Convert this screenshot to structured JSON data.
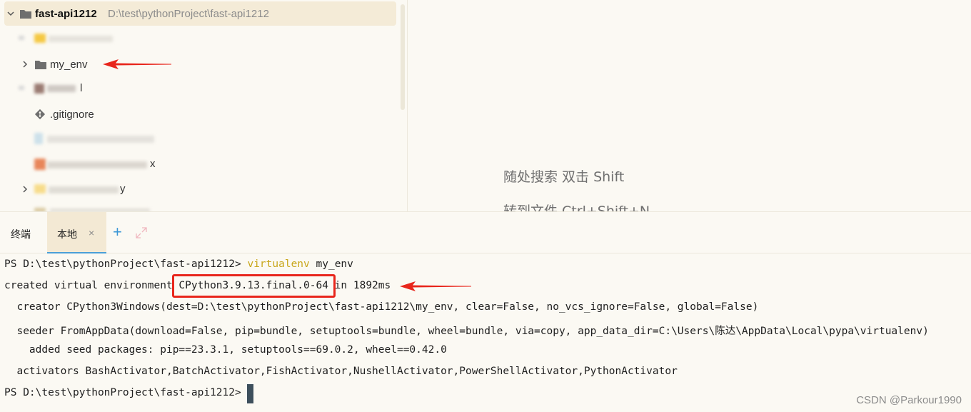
{
  "project": {
    "root_name": "fast-api1212",
    "root_path": "D:\\test\\pythonProject\\fast-api1212",
    "items": [
      {
        "label": "my_env",
        "kind": "folder",
        "expandable": true
      },
      {
        "label": ".gitignore",
        "kind": "file",
        "expandable": false
      }
    ],
    "blurred_fragments": [
      "l",
      "x",
      "y"
    ]
  },
  "editor": {
    "hints": [
      "随处搜索 双击 Shift",
      "转到文件 Ctrl+Shift+N"
    ]
  },
  "tool_window": {
    "title": "终端",
    "tabs": [
      {
        "label": "本地",
        "close_glyph": "×"
      }
    ],
    "add_glyph": "+"
  },
  "terminal": {
    "lines": [
      {
        "prompt": "PS D:\\test\\pythonProject\\fast-api1212> ",
        "command": "virtualenv",
        "args": " my_env"
      },
      {
        "text": "created virtual environment CPython3.9.13.final.0-64 in 1892ms"
      },
      {
        "text": "  creator CPython3Windows(dest=D:\\test\\pythonProject\\fast-api1212\\my_env, clear=False, no_vcs_ignore=False, global=False)"
      },
      {
        "text": "  seeder FromAppData(download=False, pip=bundle, setuptools=bundle, wheel=bundle, via=copy, app_data_dir=C:\\Users\\陈达\\AppData\\Local\\pypa\\virtualenv)"
      },
      {
        "text": "    added seed packages: pip==23.3.1, setuptools==69.0.2, wheel==0.42.0"
      },
      {
        "text": "  activators BashActivator,BatchActivator,FishActivator,NushellActivator,PowerShellActivator,PythonActivator"
      },
      {
        "text": "PS D:\\test\\pythonProject\\fast-api1212> "
      }
    ]
  },
  "watermark": "CSDN @Parkour1990",
  "colors": {
    "annotation_red": "#e8261c",
    "accent_blue": "#3a96d6",
    "command_yellow": "#c8a61a",
    "selection_bg": "#f4ebd7"
  }
}
